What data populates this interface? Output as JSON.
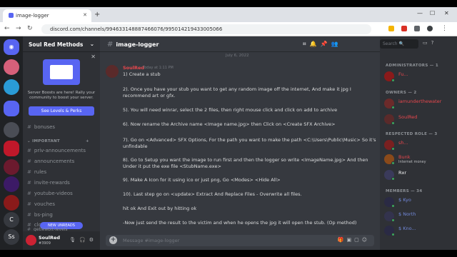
{
  "browser": {
    "tab_title": "image-logger",
    "url": "discord.com/channels/994633148887466076/995014219433005066"
  },
  "server": {
    "name": "Soul Red Methods",
    "boost": {
      "text": "Server Boosts are here! Rally your community to boost your server.",
      "button": "See Levels & Perks"
    },
    "partial_channel": "bonuses",
    "category": "IMPORTANT",
    "channels": [
      "priv-announcements",
      "announcements",
      "rules",
      "invite-rewards",
      "youtube-videos",
      "vouches",
      "bs-ping",
      "clowns"
    ],
    "new_unreads": "NEW UNREADS",
    "last_partial": "getlewbit-levels"
  },
  "user": {
    "name": "SoulRed",
    "tag": "#3909"
  },
  "channel": {
    "name": "image-logger",
    "composer_placeholder": "Message #image-logger"
  },
  "date_separator": "July 6, 2022",
  "message": {
    "author": "SoulRed",
    "timestamp": "Today at 1:11 PM",
    "lines": [
      "1) Create a stub",
      "2). Once you have your stub you want to get any random image off the internet, And make it jpg I recommend art or gfx.",
      "5). You will need winrar,  select the 2 files, then right mouse click and click on add to archive",
      "6). Now rename the Archive name <Image name.jpg> then Click on <Create SFX Archive>",
      "7). Go on  <Advanced> SFX Options, For the path you want to make the path <C:\\Users\\Public\\Music> So it's unfindable",
      "8). Go to Setup you want the image to run first and then the logger so write <ImageName.jpg> And then Under it put the exe file <StubName.exe>",
      "9). Make A Icon for it using ico or just png, Go <Modes> <Hide All>",
      "10). Last step go on <update> Extract And Replace Files - Overwrite all files.",
      "hit ok And Exit out by hitting ok",
      "-Now just send the result to the victim and when he opens the jpg it will open the stub. (Op method)"
    ]
  },
  "members": {
    "search": "Search",
    "admins_header": "ADMINISTRATORS — 1",
    "admin": "Fu...",
    "owners_header": "OWNERS — 2",
    "owners": [
      "iamunderthewater",
      "SoulRed"
    ],
    "respected_header": "RESPECTED ROLE — 3",
    "respected": [
      {
        "name": "sh...",
        "sub": ""
      },
      {
        "name": "Bunk",
        "sub": "Internet money"
      },
      {
        "name": "Rxr",
        "sub": ""
      }
    ],
    "members_header": "MEMBERS — 34",
    "members": [
      "$ Kyo",
      "$ North",
      "$ Kno..."
    ]
  }
}
